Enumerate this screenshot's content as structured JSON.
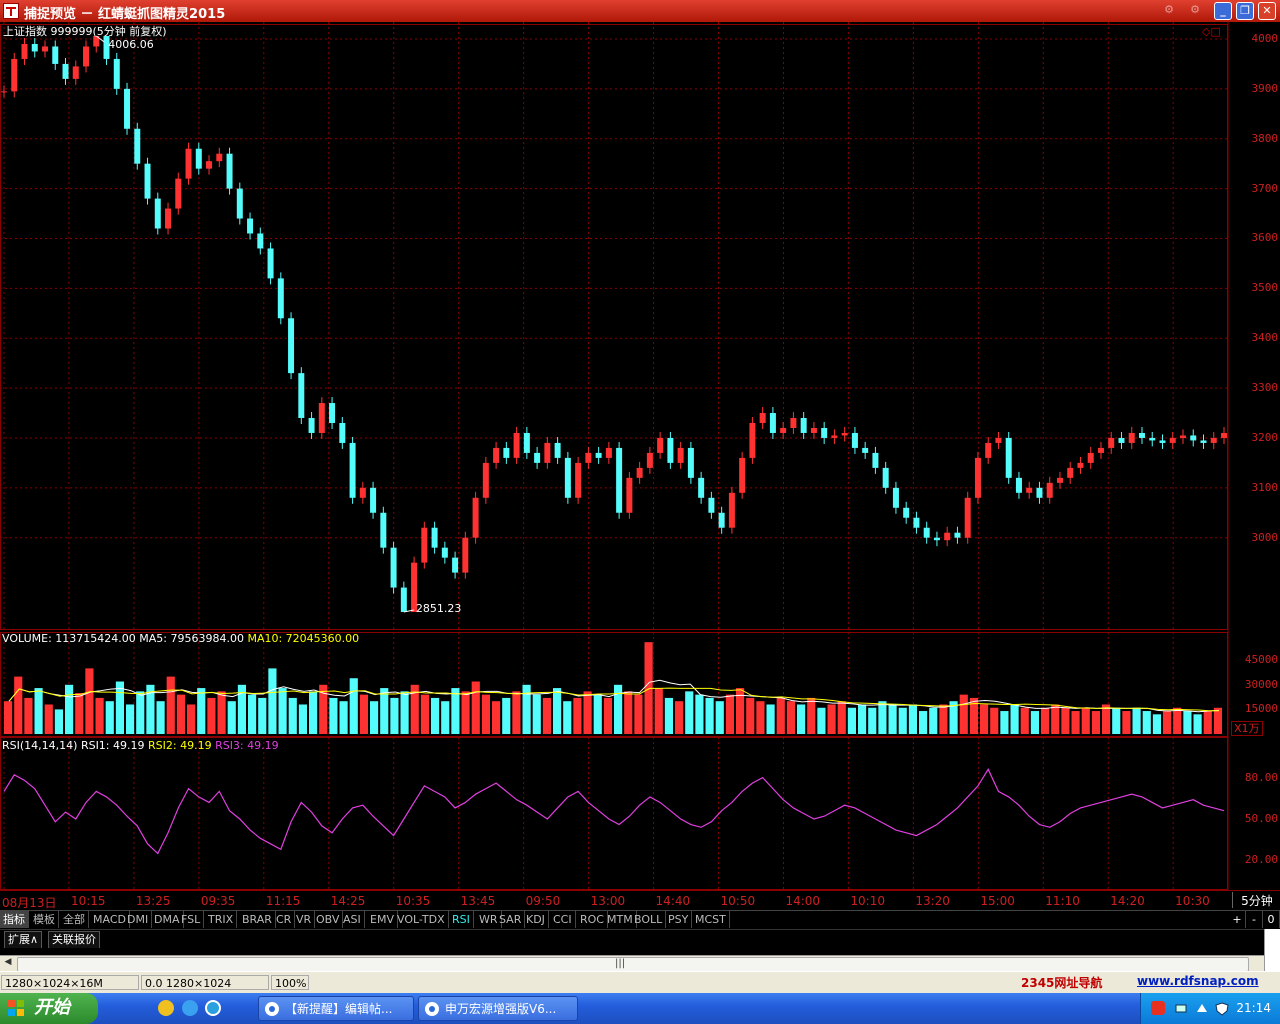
{
  "window": {
    "title": "捕捉预览 － 红蜻蜓抓图精灵2015"
  },
  "chart": {
    "header": "上证指数 999999(5分钟 前复权)",
    "high_label": "4006.06",
    "low_label": "2851.23",
    "volume_header": {
      "prefix": "VOLUME: 113715424.00",
      "ma5": "MA5: 79563984.00",
      "ma10": "MA10: 72045360.00"
    },
    "volume_unit": "X1万",
    "rsi_header": {
      "prefix": "RSI(14,14,14)",
      "rsi1": "RSI1: 49.19",
      "rsi2": "RSI2: 49.19",
      "rsi3": "RSI3: 49.19"
    },
    "period": "5分钟",
    "colors": {
      "up": "#ff3232",
      "down": "#54fcfc",
      "grid": "#8b0000",
      "rsi": "#e040e0",
      "ma5": "#ffffff",
      "ma10": "#ffff00"
    }
  },
  "chart_data": [
    {
      "type": "candlestick",
      "name_on_chart": "上证指数 999999",
      "ylim": [
        2851,
        4006
      ],
      "y_ticks": [
        "4000",
        "3900",
        "3800",
        "3700",
        "3600",
        "3500",
        "3400",
        "3300",
        "3200",
        "3100",
        "3000"
      ],
      "x_ticks": [
        "08月13日",
        "10:15",
        "13:25",
        "09:35",
        "11:15",
        "14:25",
        "10:35",
        "13:45",
        "09:50",
        "13:00",
        "14:40",
        "10:50",
        "14:00",
        "10:10",
        "13:20",
        "15:00",
        "11:10",
        "14:20",
        "10:30"
      ],
      "x": [
        0,
        1,
        2,
        3,
        4,
        5,
        6,
        7,
        8,
        9,
        10,
        11,
        12,
        13,
        14,
        15,
        16,
        17,
        18,
        19,
        20,
        21,
        22,
        23,
        24,
        25,
        26,
        27,
        28,
        29,
        30,
        31,
        32,
        33,
        34,
        35,
        36,
        37,
        38,
        39,
        40,
        41,
        42,
        43,
        44,
        45,
        46,
        47,
        48,
        49,
        50,
        51,
        52,
        53,
        54,
        55,
        56,
        57,
        58,
        59,
        60,
        61,
        62,
        63,
        64,
        65,
        66,
        67,
        68,
        69,
        70,
        71,
        72,
        73,
        74,
        75,
        76,
        77,
        78,
        79,
        80,
        81,
        82,
        83,
        84,
        85,
        86,
        87,
        88,
        89,
        90,
        91,
        92,
        93,
        94,
        95,
        96,
        97,
        98,
        99,
        100,
        101,
        102,
        103,
        104,
        105,
        106,
        107,
        108,
        109,
        110,
        111,
        112,
        113,
        114,
        115,
        116,
        117,
        118,
        119
      ],
      "close": [
        3895,
        3960,
        3990,
        3975,
        3985,
        3950,
        3920,
        3945,
        3985,
        4006,
        3960,
        3900,
        3820,
        3750,
        3680,
        3620,
        3660,
        3720,
        3780,
        3740,
        3755,
        3770,
        3700,
        3640,
        3610,
        3580,
        3520,
        3440,
        3330,
        3240,
        3210,
        3270,
        3230,
        3190,
        3080,
        3100,
        3050,
        2980,
        2900,
        2851,
        2950,
        3020,
        2980,
        2960,
        2930,
        3000,
        3080,
        3150,
        3180,
        3160,
        3210,
        3170,
        3150,
        3190,
        3160,
        3080,
        3150,
        3170,
        3160,
        3180,
        3050,
        3120,
        3140,
        3170,
        3200,
        3150,
        3180,
        3120,
        3080,
        3050,
        3020,
        3090,
        3160,
        3230,
        3250,
        3210,
        3220,
        3240,
        3210,
        3220,
        3200,
        3205,
        3210,
        3180,
        3170,
        3140,
        3100,
        3060,
        3040,
        3020,
        3000,
        2995,
        3010,
        3000,
        3080,
        3160,
        3190,
        3200,
        3120,
        3090,
        3100,
        3080,
        3110,
        3120,
        3140,
        3150,
        3170,
        3180,
        3200,
        3190,
        3210,
        3200,
        3195,
        3190,
        3200,
        3205,
        3195,
        3190,
        3200,
        3210
      ]
    },
    {
      "type": "bar",
      "name_on_chart": "VOLUME",
      "y_ticks": [
        "45000",
        "30000",
        "15000"
      ],
      "ylim": [
        0,
        50000
      ],
      "values": [
        20000,
        35000,
        22000,
        28000,
        18000,
        15000,
        30000,
        25000,
        40000,
        22000,
        20000,
        32000,
        18000,
        26000,
        30000,
        20000,
        35000,
        24000,
        18000,
        28000,
        22000,
        26000,
        20000,
        30000,
        24000,
        22000,
        40000,
        28000,
        22000,
        18000,
        26000,
        30000,
        22000,
        20000,
        34000,
        24000,
        20000,
        28000,
        22000,
        26000,
        30000,
        24000,
        22000,
        20000,
        28000,
        26000,
        32000,
        24000,
        20000,
        22000,
        26000,
        30000,
        24000,
        22000,
        28000,
        20000,
        22000,
        26000,
        24000,
        22000,
        30000,
        26000,
        24000,
        56000,
        28000,
        22000,
        20000,
        26000,
        24000,
        22000,
        20000,
        24000,
        28000,
        22000,
        20000,
        18000,
        22000,
        20000,
        18000,
        22000,
        16000,
        18000,
        20000,
        16000,
        18000,
        16000,
        20000,
        18000,
        16000,
        18000,
        14000,
        16000,
        18000,
        20000,
        24000,
        22000,
        18000,
        16000,
        14000,
        18000,
        16000,
        14000,
        16000,
        18000,
        16000,
        14000,
        16000,
        14000,
        18000,
        16000,
        14000,
        16000,
        14000,
        12000,
        14000,
        16000,
        14000,
        12000,
        14000,
        16000
      ]
    },
    {
      "type": "line",
      "name_on_chart": "RSI",
      "y_ticks": [
        "80.00",
        "50.00",
        "20.00"
      ],
      "ylim": [
        0,
        100
      ],
      "values": [
        70,
        82,
        78,
        72,
        60,
        48,
        55,
        50,
        62,
        70,
        66,
        60,
        52,
        45,
        32,
        25,
        40,
        58,
        72,
        66,
        62,
        70,
        56,
        50,
        42,
        36,
        32,
        28,
        48,
        62,
        55,
        45,
        40,
        50,
        58,
        60,
        52,
        45,
        38,
        50,
        62,
        74,
        70,
        66,
        58,
        62,
        68,
        72,
        76,
        70,
        64,
        60,
        55,
        50,
        58,
        66,
        70,
        62,
        56,
        50,
        46,
        52,
        60,
        66,
        62,
        56,
        50,
        46,
        44,
        48,
        56,
        62,
        70,
        76,
        80,
        72,
        64,
        58,
        54,
        50,
        52,
        56,
        60,
        58,
        54,
        50,
        46,
        42,
        40,
        38,
        42,
        46,
        52,
        58,
        66,
        74,
        86,
        70,
        66,
        60,
        52,
        46,
        44,
        48,
        54,
        58,
        60,
        62,
        64,
        66,
        68,
        66,
        62,
        58,
        60,
        62,
        64,
        60,
        58,
        56
      ]
    }
  ],
  "indicator_tabs": [
    "指标",
    "模板",
    "全部",
    "MACD",
    "DMI",
    "DMA",
    "FSL",
    "TRIX",
    "BRAR",
    "CR",
    "VR",
    "OBV",
    "ASI",
    "EMV",
    "VOL-TDX",
    "RSI",
    "WR",
    "SAR",
    "KDJ",
    "CCI",
    "ROC",
    "MTM",
    "BOLL",
    "PSY",
    "MCST"
  ],
  "active_tab": "RSI",
  "zoom_buttons": [
    "+",
    "-",
    "0"
  ],
  "sub_tabs": [
    "扩展∧",
    "关联报价"
  ],
  "statusbar": {
    "size": "1280×1024×16M",
    "coords": "0.0 1280×1024",
    "zoom": "100%",
    "link1": "2345网址导航",
    "link2": "www.rdfsnap.com"
  },
  "taskbar": {
    "start": "开始",
    "tasks": [
      "【新提醒】编辑帖...",
      "申万宏源增强版V6..."
    ],
    "clock": "21:14"
  }
}
